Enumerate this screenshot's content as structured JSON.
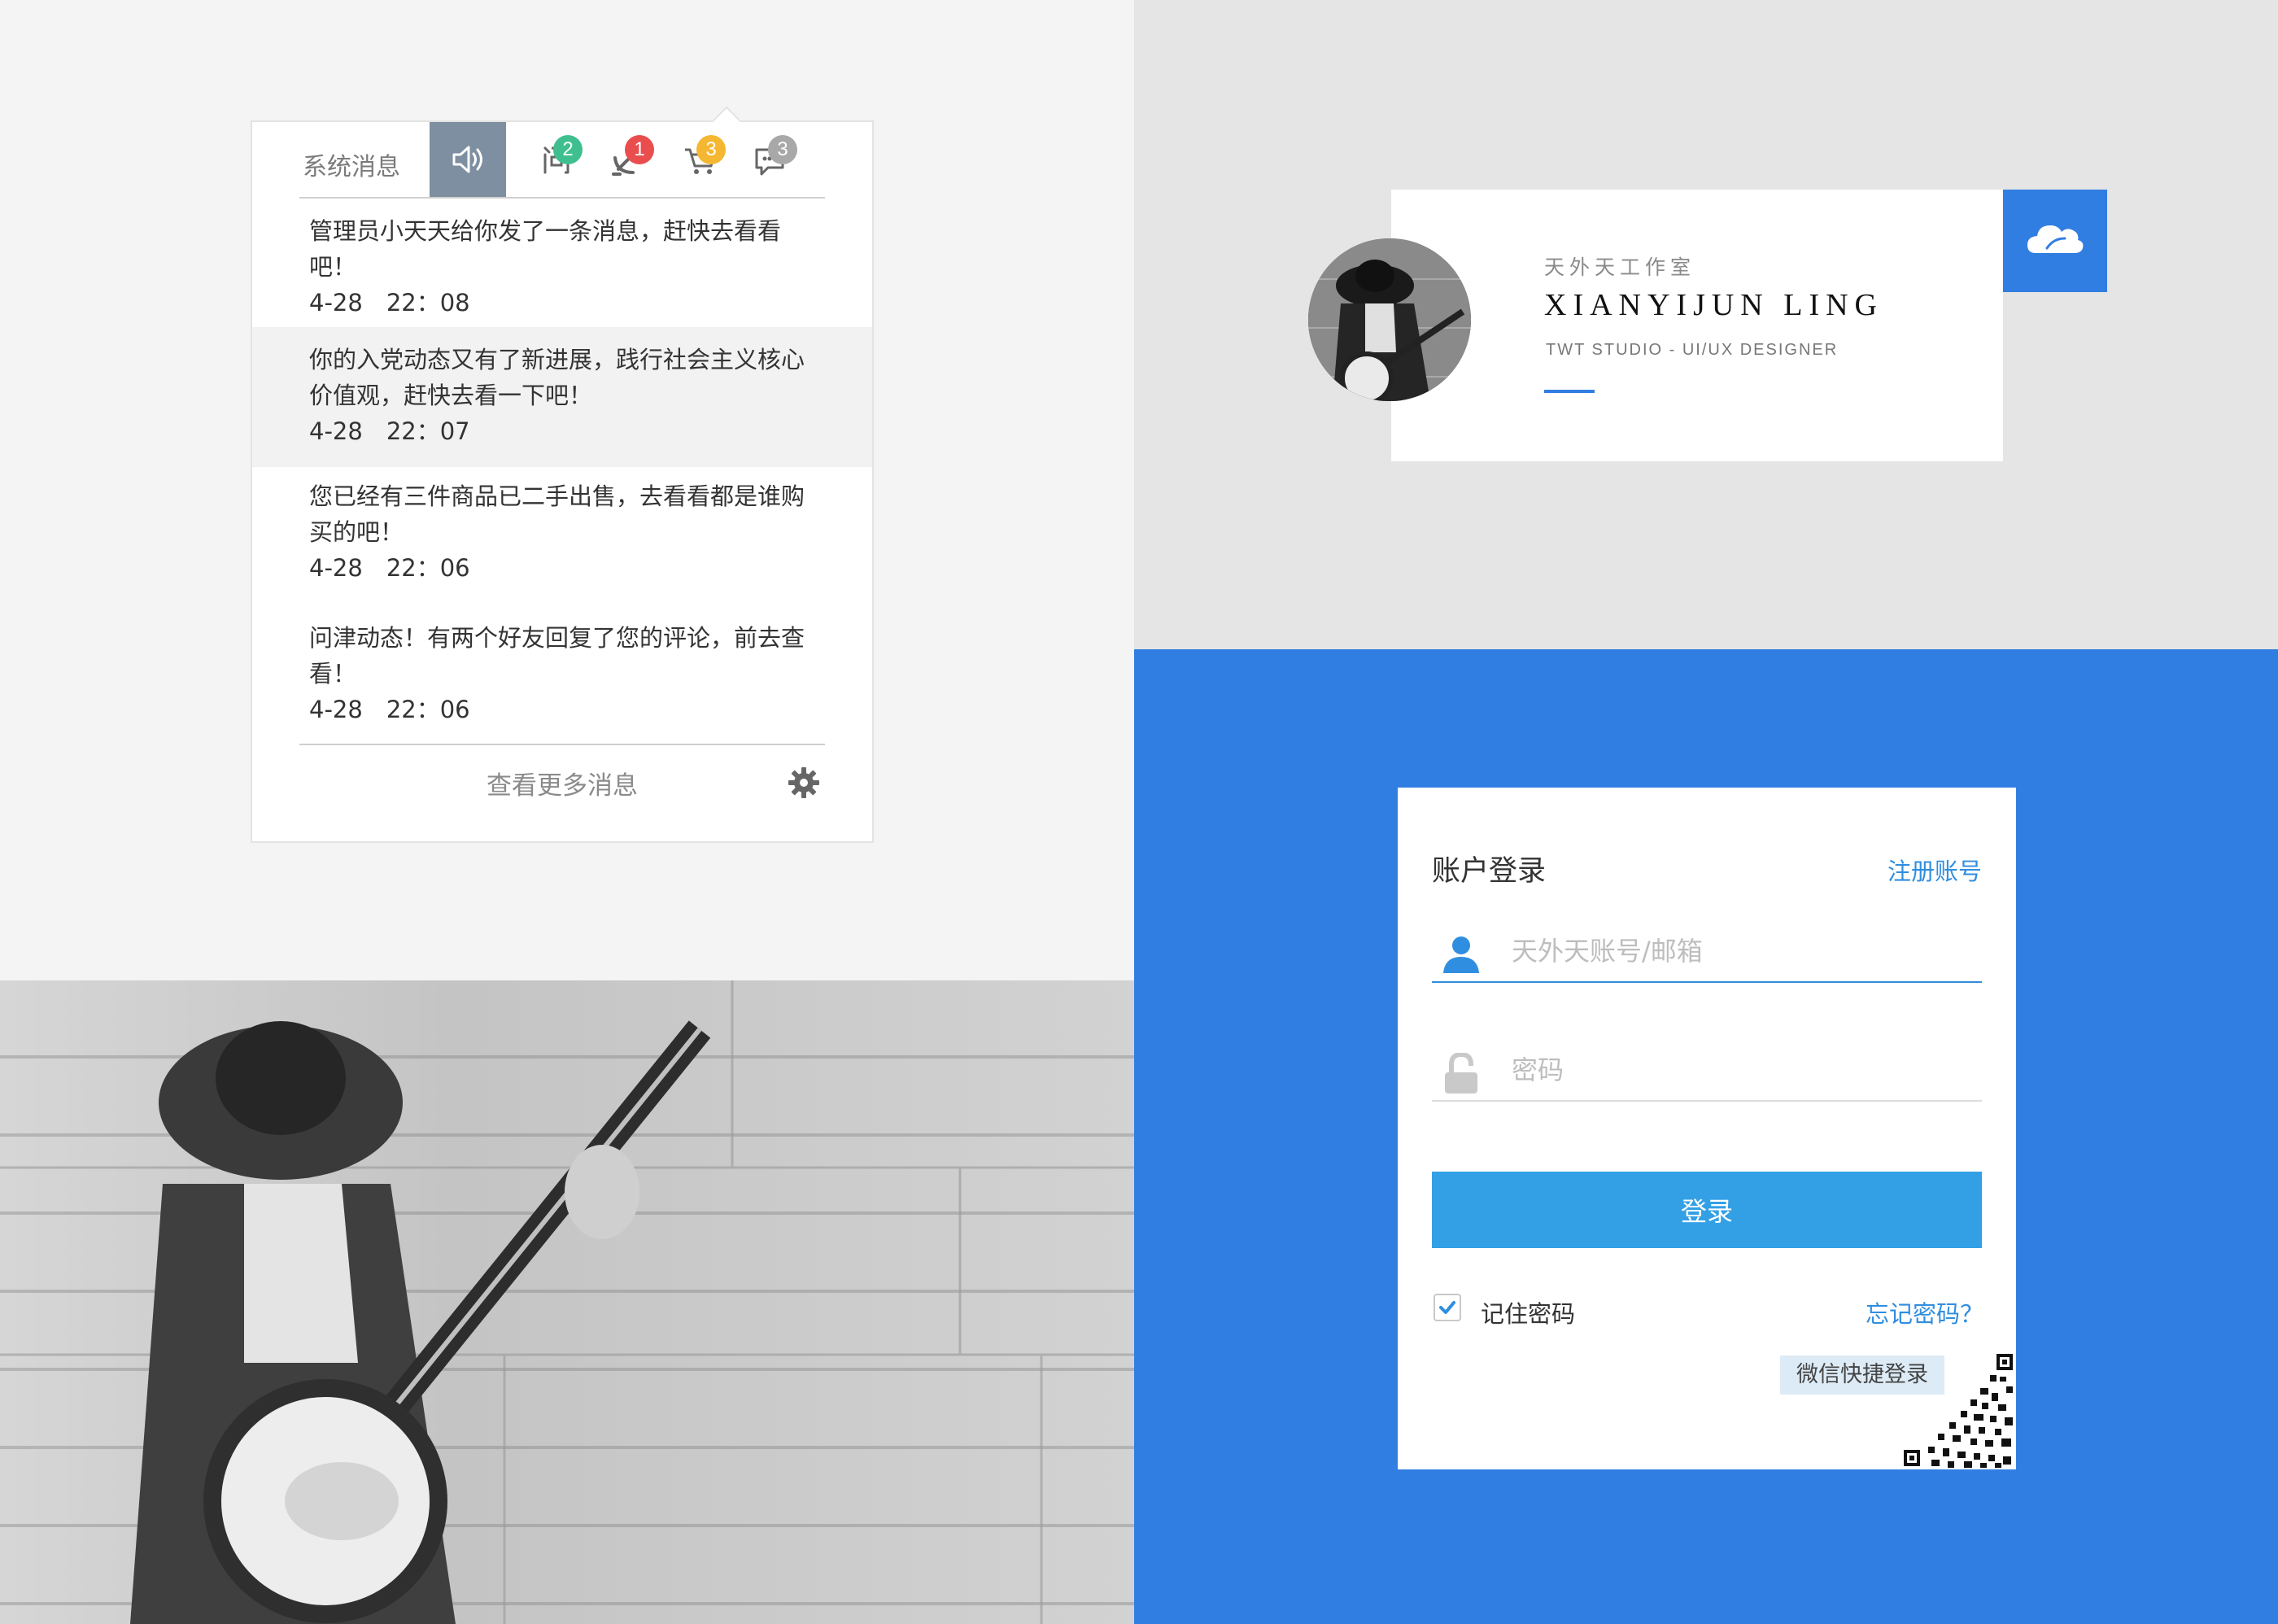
{
  "notifications": {
    "tab_title": "系统消息",
    "tabs": [
      {
        "icon": "speaker-icon",
        "badge": ""
      },
      {
        "icon": "question-icon",
        "badge": "2",
        "badge_color": "#3fbf8f"
      },
      {
        "icon": "hammer-sickle-icon",
        "badge": "1",
        "badge_color": "#e94d4d"
      },
      {
        "icon": "cart-icon",
        "badge": "3",
        "badge_color": "#f5b731"
      },
      {
        "icon": "chat-icon",
        "badge": "3",
        "badge_color": "#a8a8a8"
      }
    ],
    "messages": [
      {
        "text": "管理员小天天给你发了一条消息，赶快去看看吧！",
        "time": "4-28　22：08"
      },
      {
        "text": "你的入党动态又有了新进展，践行社会主义核心价值观，赶快去看一下吧！",
        "time": "4-28　22：07"
      },
      {
        "text": "您已经有三件商品已二手出售，去看看都是谁购买的吧！",
        "time": "4-28　22：06"
      },
      {
        "text": "问津动态！有两个好友回复了您的评论，前去查看！",
        "time": "4-28　22：06"
      }
    ],
    "more_label": "查看更多消息"
  },
  "profile": {
    "studio_cn": "天外天工作室",
    "name": "XIANYIJUN LING",
    "subtitle": "TWT STUDIO - UI/UX DESIGNER"
  },
  "login": {
    "title": "账户登录",
    "register_label": "注册账号",
    "username_placeholder": "天外天账号/邮箱",
    "password_placeholder": "密码",
    "submit_label": "登录",
    "remember_label": "记住密码",
    "forgot_label": "忘记密码？",
    "wechat_label": "微信快捷登录"
  },
  "colors": {
    "brand_blue": "#317ee2",
    "button_blue": "#33a0e6",
    "link_blue": "#2f8ee0"
  }
}
